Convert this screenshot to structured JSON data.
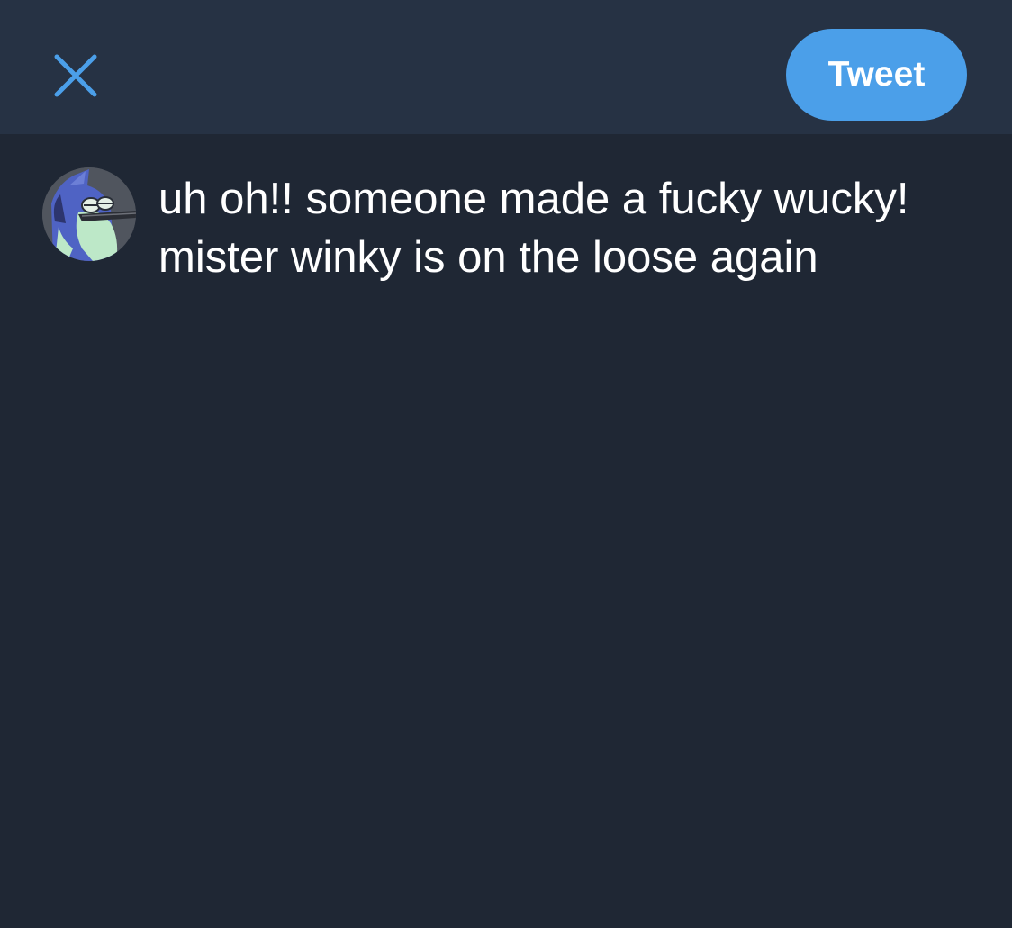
{
  "header": {
    "close_icon": "close-icon",
    "tweet_button_label": "Tweet",
    "accent_color": "#4b9fe9"
  },
  "composer": {
    "avatar_icon": "avatar",
    "text": "uh oh!! someone made a fucky wucky! mister winky is on the loose again"
  },
  "colors": {
    "header_background": "#263244",
    "body_background": "#1f2734",
    "text": "#ffffff"
  }
}
